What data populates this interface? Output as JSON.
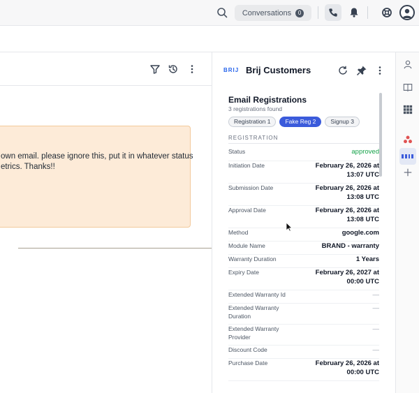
{
  "topbar": {
    "conversations_label": "Conversations",
    "conversations_count": "0"
  },
  "main": {
    "note_line1": "own email. please ignore this, put it in whatever status",
    "note_line2": "etrics. Thanks!!"
  },
  "panel": {
    "logo_text": "BRIJ",
    "title": "Brij Customers",
    "card_title": "Email Registrations",
    "card_subtitle": "3 registrations found",
    "tabs": [
      {
        "label": "Registration 1",
        "active": false
      },
      {
        "label": "Fake Reg 2",
        "active": true
      },
      {
        "label": "Signup 3",
        "active": false
      }
    ],
    "section_label": "REGISTRATION",
    "fields": [
      {
        "key": "Status",
        "value": "approved"
      },
      {
        "key": "Initiation Date",
        "value": "February 26, 2026 at 13:07 UTC"
      },
      {
        "key": "Submission Date",
        "value": "February 26, 2026 at 13:08 UTC"
      },
      {
        "key": "Approval Date",
        "value": "February 26, 2026 at 13:08 UTC"
      },
      {
        "key": "Method",
        "value": "google.com"
      },
      {
        "key": "Module Name",
        "value": "BRAND - warranty"
      },
      {
        "key": "Warranty Duration",
        "value": "1 Years"
      },
      {
        "key": "Expiry Date",
        "value": "February 26, 2027 at 00:00 UTC"
      },
      {
        "key": "Extended Warranty Id",
        "value": "—"
      },
      {
        "key": "Extended Warranty Duration",
        "value": "—"
      },
      {
        "key": "Extended Warranty Provider",
        "value": "—"
      },
      {
        "key": "Discount Code",
        "value": "—"
      },
      {
        "key": "Purchase Date",
        "value": "February 26, 2026 at 00:00 UTC"
      }
    ]
  },
  "colors": {
    "accent": "#3b5bdb",
    "approved": "#16a34a",
    "note_bg": "#fdebd8"
  },
  "icons": [
    "search-icon",
    "phone-icon",
    "bell-icon",
    "lifebuoy-icon",
    "avatar",
    "filter-icon",
    "history-icon",
    "more-vertical-icon",
    "refresh-icon",
    "pin-icon",
    "person-icon",
    "book-icon",
    "grid-icon",
    "apps-icon",
    "brij-icon",
    "plus-icon"
  ]
}
